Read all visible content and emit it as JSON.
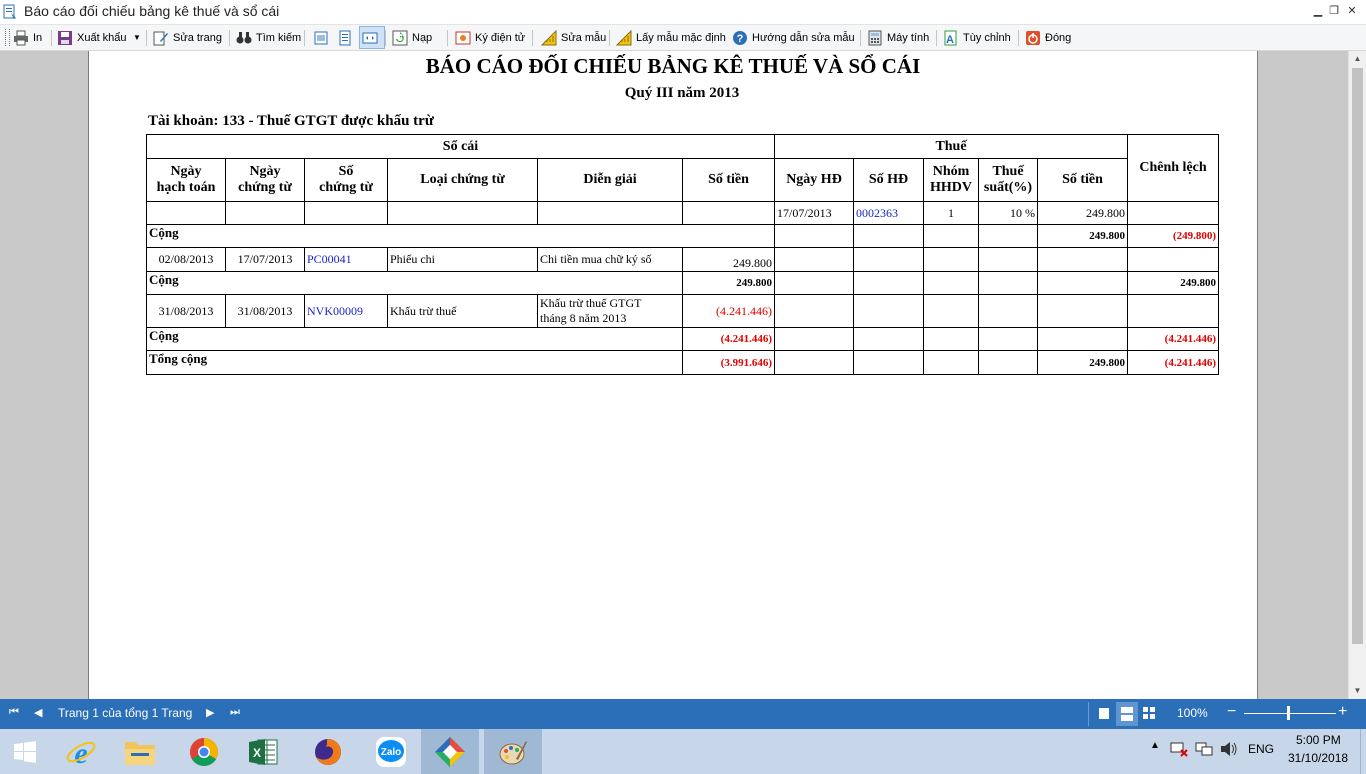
{
  "window": {
    "title": "Báo cáo đối chiếu bảng kê thuế và sổ cái"
  },
  "toolbar": {
    "print": "In",
    "export": "Xuất khẩu",
    "edit_page": "Sửa trang",
    "find": "Tìm kiếm",
    "load": "Nạp",
    "sign": "Ký điện tử",
    "edit_template": "Sửa mẫu",
    "default_template": "Lấy mẫu mặc định",
    "template_guide": "Hướng dẫn sửa mẫu",
    "calculator": "Máy tính",
    "customize": "Tùy chỉnh",
    "close": "Đóng"
  },
  "report": {
    "title": "BÁO CÁO ĐỐI CHIẾU BẢNG KÊ THUẾ VÀ SỔ CÁI",
    "subtitle": "Quý III năm 2013",
    "account": "Tài khoản: 133 - Thuế GTGT được khấu trừ",
    "headers": {
      "ledger": "Sổ cái",
      "tax": "Thuế",
      "difference": "Chênh lệch",
      "posting_date_1": "Ngày",
      "posting_date_2": "hạch toán",
      "voucher_date_1": "Ngày",
      "voucher_date_2": "chứng từ",
      "voucher_no_1": "Số",
      "voucher_no_2": "chứng từ",
      "voucher_type": "Loại chứng từ",
      "description": "Diễn giải",
      "amount": "Số tiền",
      "invoice_date": "Ngày HĐ",
      "invoice_no": "Số HĐ",
      "group_1": "Nhóm",
      "group_2": "HHDV",
      "rate_1": "Thuế",
      "rate_2": "suất(%)",
      "tax_amount": "Số tiền"
    },
    "rows": {
      "r1": {
        "invoice_date": "17/07/2013",
        "invoice_no": "0002363",
        "group": "1",
        "rate": "10 %",
        "tax_amount": "249.800"
      },
      "s1": {
        "label": "Cộng",
        "tax_amount": "249.800",
        "difference": "(249.800)"
      },
      "r2": {
        "posting_date": "02/08/2013",
        "voucher_date": "17/07/2013",
        "voucher_no": "PC00041",
        "voucher_type": "Phiếu chi",
        "description": "Chi tiền mua chữ ký số",
        "amount": "249.800"
      },
      "s2": {
        "label": "Cộng",
        "amount": "249.800",
        "difference": "249.800"
      },
      "r3": {
        "posting_date": "31/08/2013",
        "voucher_date": "31/08/2013",
        "voucher_no": "NVK00009",
        "voucher_type": "Khấu trừ thuế",
        "description_1": "Khấu trừ thuế GTGT",
        "description_2": "tháng 8 năm 2013",
        "amount": "(4.241.446)"
      },
      "s3": {
        "label": "Cộng",
        "amount": "(4.241.446)",
        "difference": "(4.241.446)"
      },
      "total": {
        "label": "Tổng cộng",
        "amount": "(3.991.646)",
        "tax_amount": "249.800",
        "difference": "(4.241.446)"
      }
    }
  },
  "statusbar": {
    "page_info": "Trang 1 của tổng 1 Trang",
    "zoom": "100%"
  },
  "taskbar": {
    "apps": [
      "windows-start",
      "internet-explorer",
      "file-explorer",
      "chrome",
      "excel",
      "firefox",
      "zalo",
      "misa",
      "paint"
    ],
    "language": "ENG",
    "time": "5:00 PM",
    "date": "31/10/2018"
  },
  "colors": {
    "negative": "#e00000",
    "link": "#1a25c8",
    "statusbar": "#2a6fb8",
    "taskbar": "#c7d6e8"
  }
}
